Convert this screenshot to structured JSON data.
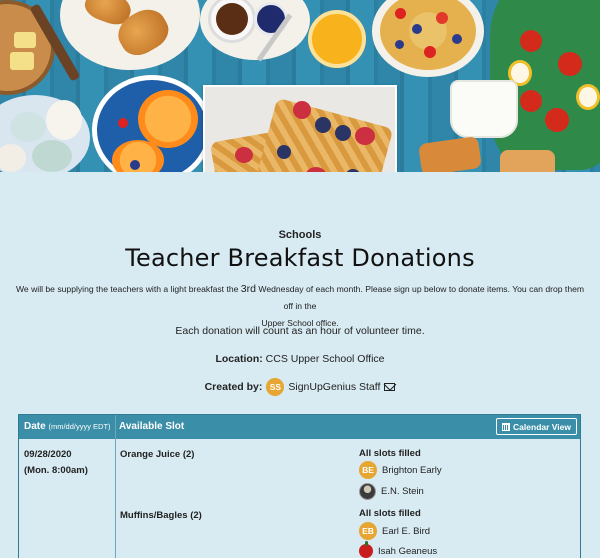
{
  "header": {
    "category": "Schools",
    "title": "Teacher Breakfast Donations"
  },
  "description": {
    "line1_part1": "We will be supplying the teachers with a light breakfast the ",
    "line1_big": "3rd",
    "line1_part2": " Wednesday of each month.  Please sign up below to donate items. You can drop them off in the",
    "line2": "Upper School office.",
    "credit": "Each donation will count as an hour of volunteer time."
  },
  "location": {
    "label": "Location:",
    "value": "CCS Upper School Office"
  },
  "created_by": {
    "label": "Created by:",
    "initials": "SS",
    "name": "SignUpGenius Staff",
    "mail_icon": "envelope-icon"
  },
  "table": {
    "headers": {
      "date": "Date",
      "date_format": "(mm/dd/yyyy EDT)",
      "slot": "Available Slot"
    },
    "calendar_button": "Calendar View",
    "rows": [
      {
        "date": "09/28/2020",
        "time": "(Mon. 8:00am)",
        "slots": [
          {
            "item": "Orange Juice (2)",
            "status": "All slots filled",
            "people": [
              {
                "initials": "BE",
                "name": "Brighton Early",
                "avatar": "initials"
              },
              {
                "initials": "",
                "name": "E.N. Stein",
                "avatar": "photo"
              }
            ]
          },
          {
            "item": "Muffins/Bagles (2)",
            "status": "All slots filled",
            "people": [
              {
                "initials": "EB",
                "name": "Earl E. Bird",
                "avatar": "initials"
              },
              {
                "initials": "",
                "name": "Isah Geaneus",
                "avatar": "apple-icon"
              }
            ]
          }
        ]
      }
    ]
  },
  "colors": {
    "background": "#d8ebf2",
    "table_header": "#3a8ea8",
    "avatar": "#e7a531"
  }
}
